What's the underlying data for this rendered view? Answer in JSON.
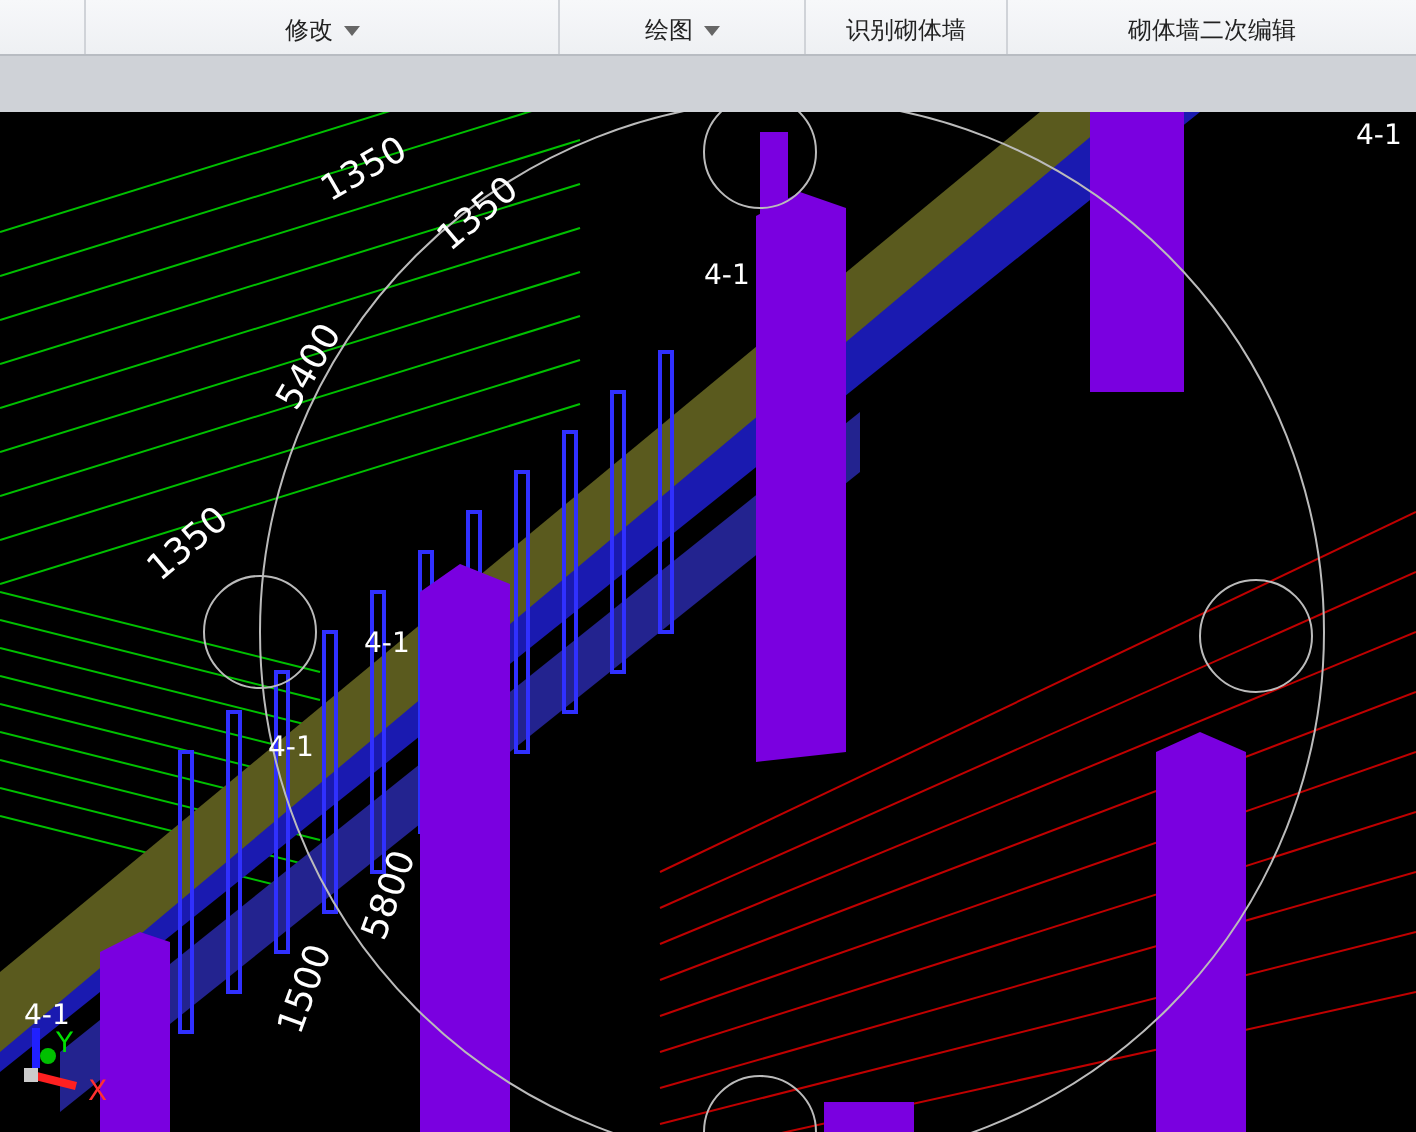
{
  "ribbon": {
    "groups": [
      {
        "label": "修改",
        "dropdown": true
      },
      {
        "label": "绘图",
        "dropdown": true
      },
      {
        "label": "识别砌体墙",
        "dropdown": false
      },
      {
        "label": "砌体墙二次编辑",
        "dropdown": false
      }
    ]
  },
  "viewport": {
    "labels": [
      {
        "text": "1350",
        "kind": "dimension"
      },
      {
        "text": "1350",
        "kind": "dimension"
      },
      {
        "text": "5400",
        "kind": "dimension"
      },
      {
        "text": "1350",
        "kind": "dimension"
      },
      {
        "text": "5800",
        "kind": "dimension"
      },
      {
        "text": "1500",
        "kind": "dimension"
      },
      {
        "text": "4-1",
        "kind": "axis"
      },
      {
        "text": "4-1",
        "kind": "axis"
      },
      {
        "text": "4-1",
        "kind": "axis"
      },
      {
        "text": "4-1",
        "kind": "axis"
      },
      {
        "text": "4-1",
        "kind": "axis"
      }
    ],
    "gizmo": {
      "y_label": "Y",
      "x_label": "X"
    }
  }
}
